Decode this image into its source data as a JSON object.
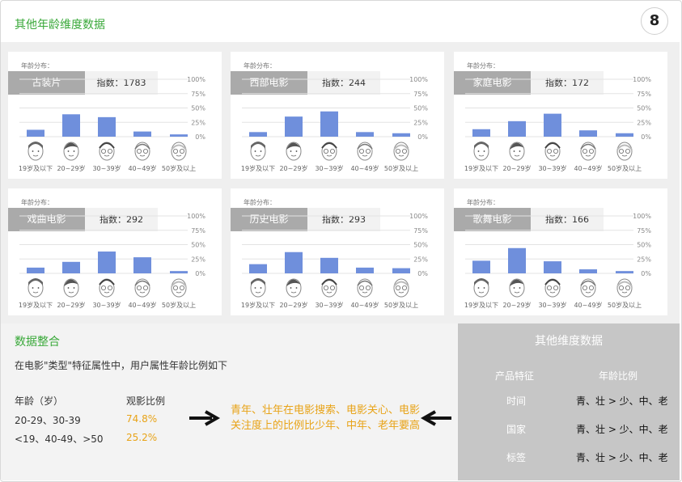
{
  "page": {
    "title": "其他年龄维度数据",
    "page_number": "8"
  },
  "cards": [
    {
      "dist_label": "年龄分布：",
      "genre": "古装片",
      "index_text": "指数：1783"
    },
    {
      "dist_label": "年龄分布：",
      "genre": "西部电影",
      "index_text": "指数：244"
    },
    {
      "dist_label": "年龄分布：",
      "genre": "家庭电影",
      "index_text": "指数：172"
    },
    {
      "dist_label": "年龄分布：",
      "genre": "戏曲电影",
      "index_text": "指数：292"
    },
    {
      "dist_label": "年龄分布：",
      "genre": "历史电影",
      "index_text": "指数：293"
    },
    {
      "dist_label": "年龄分布：",
      "genre": "歌舞电影",
      "index_text": "指数：166"
    }
  ],
  "chart_data": [
    {
      "type": "bar",
      "categories": [
        "19岁及以下",
        "20~29岁",
        "30~39岁",
        "40~49岁",
        "50岁及以上"
      ],
      "values": [
        12,
        39,
        34,
        9,
        4
      ],
      "yticks": [
        "100%",
        "75%",
        "50%",
        "25%",
        "0%"
      ],
      "ylim": [
        0,
        100
      ],
      "bar_color": "#6f8fdc"
    },
    {
      "type": "bar",
      "categories": [
        "19岁及以下",
        "20~29岁",
        "30~39岁",
        "40~49岁",
        "50岁及以上"
      ],
      "values": [
        8,
        35,
        44,
        8,
        6
      ],
      "yticks": [
        "100%",
        "75%",
        "50%",
        "25%",
        "0%"
      ],
      "ylim": [
        0,
        100
      ],
      "bar_color": "#6f8fdc"
    },
    {
      "type": "bar",
      "categories": [
        "19岁及以下",
        "20~29岁",
        "30~39岁",
        "40~49岁",
        "50岁及以上"
      ],
      "values": [
        13,
        27,
        40,
        11,
        6
      ],
      "yticks": [
        "100%",
        "75%",
        "50%",
        "25%",
        "0%"
      ],
      "ylim": [
        0,
        100
      ],
      "bar_color": "#6f8fdc"
    },
    {
      "type": "bar",
      "categories": [
        "19岁及以下",
        "20~29岁",
        "30~39岁",
        "40~49岁",
        "50岁及以上"
      ],
      "values": [
        10,
        20,
        38,
        28,
        4
      ],
      "yticks": [
        "100%",
        "75%",
        "50%",
        "25%",
        "0%"
      ],
      "ylim": [
        0,
        100
      ],
      "bar_color": "#6f8fdc"
    },
    {
      "type": "bar",
      "categories": [
        "19岁及以下",
        "20~29岁",
        "30~39岁",
        "40~49岁",
        "50岁及以上"
      ],
      "values": [
        16,
        37,
        27,
        10,
        9
      ],
      "yticks": [
        "100%",
        "75%",
        "50%",
        "25%",
        "0%"
      ],
      "ylim": [
        0,
        100
      ],
      "bar_color": "#6f8fdc"
    },
    {
      "type": "bar",
      "categories": [
        "19岁及以下",
        "20~29岁",
        "30~39岁",
        "40~49岁",
        "50岁及以上"
      ],
      "values": [
        22,
        44,
        21,
        7,
        4
      ],
      "yticks": [
        "100%",
        "75%",
        "50%",
        "25%",
        "0%"
      ],
      "ylim": [
        0,
        100
      ],
      "bar_color": "#6f8fdc"
    }
  ],
  "merge": {
    "title": "数据整合",
    "desc": "在电影\"类型\"特征属性中，用户属性年龄比例如下",
    "col_age": "年龄（岁）",
    "col_ratio": "观影比例",
    "rows": [
      {
        "age": "20-29、30-39",
        "ratio": "74.8%"
      },
      {
        "age": "<19、40-49、>50",
        "ratio": "25.2%"
      }
    ],
    "conclusion": "青年、壮年在电影搜索、电影关心、电影关注度上的比例比少年、中年、老年要高"
  },
  "other": {
    "title": "其他维度数据",
    "col_feature": "产品特征",
    "col_ratio": "年龄比例",
    "rows": [
      {
        "dim": "时间",
        "val": "青、壮 > 少、中、老"
      },
      {
        "dim": "国家",
        "val": "青、壮 > 少、中、老"
      },
      {
        "dim": "标签",
        "val": "青、壮 > 少、中、老"
      }
    ]
  },
  "colors": {
    "accent_green": "#3aa93a",
    "highlight_orange": "#e8a317",
    "bar_blue": "#6f8fdc",
    "panel_gray": "#c6c6c6"
  }
}
